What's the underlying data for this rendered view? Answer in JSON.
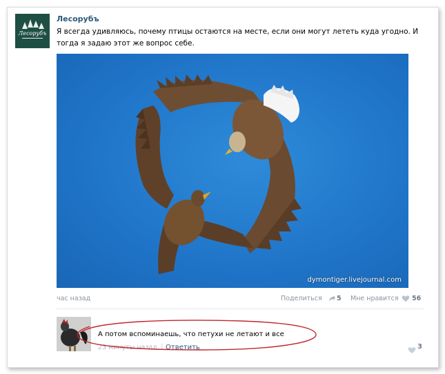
{
  "post": {
    "author": "Лесорубъ",
    "avatar_text": "Лесорубъ",
    "text": "Я всегда удивляюсь, почему птицы остаются на месте, если они могут лететь куда угодно. И тогда я задаю этот же вопрос себе.",
    "watermark": "dymontiger.livejournal.com",
    "time": "час назад",
    "share_label": "Поделиться",
    "share_count": "5",
    "like_label": "Мне нравится",
    "like_count": "56"
  },
  "comment": {
    "text": "А потом вспоминаешь, что петухи не летают и все",
    "time": "23 минуты назад",
    "separator": "|",
    "reply_label": "Ответить",
    "like_count": "3"
  },
  "colors": {
    "link": "#2b587a",
    "sky": "#1f74c8",
    "annotation": "#c0262c"
  },
  "icons": [
    "share-icon",
    "heart-icon",
    "annotation-oval"
  ]
}
